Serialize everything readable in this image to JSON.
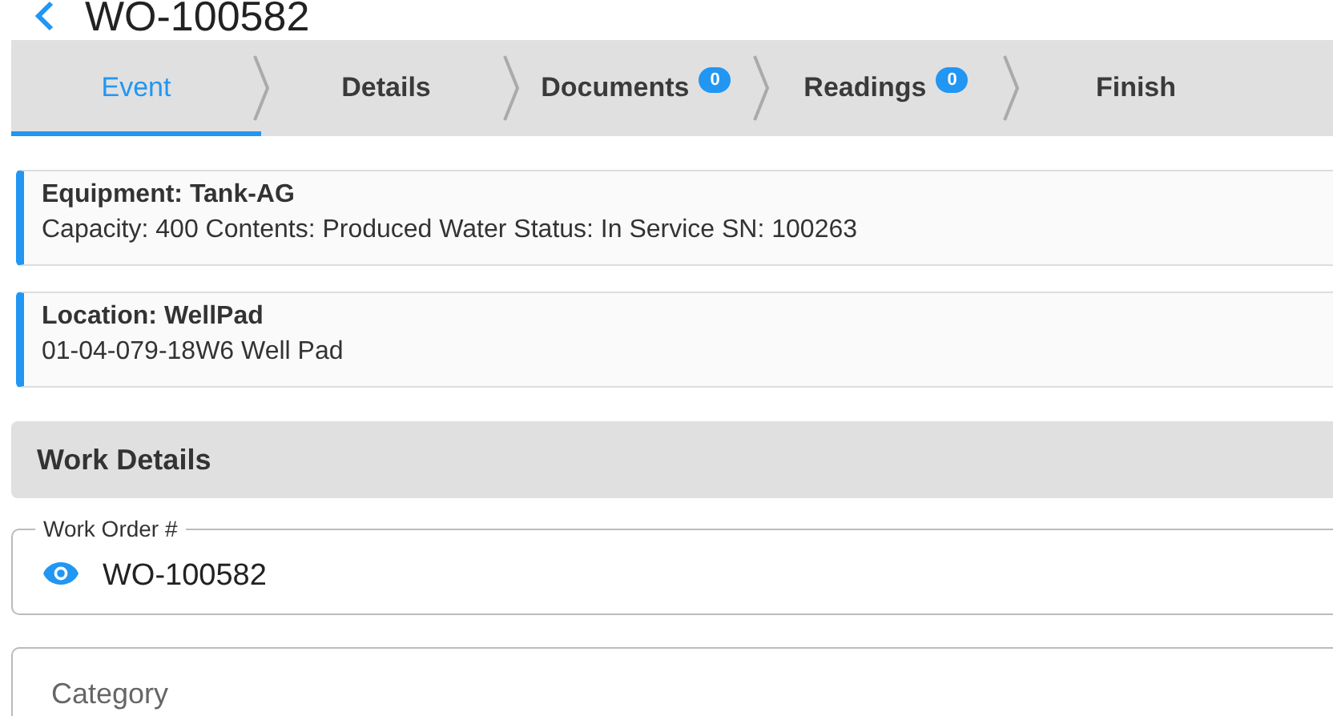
{
  "header": {
    "title": "WO-100582"
  },
  "steps": [
    {
      "label": "Event",
      "selected": true
    },
    {
      "label": "Details",
      "selected": false
    },
    {
      "label": "Documents",
      "badge": "0",
      "selected": false
    },
    {
      "label": "Readings",
      "badge": "0",
      "selected": false
    },
    {
      "label": "Finish",
      "selected": false
    }
  ],
  "info_cards": [
    {
      "title": "Equipment: Tank-AG",
      "detail": "Capacity: 400 Contents: Produced Water Status: In Service SN: 100263"
    },
    {
      "title": "Location: WellPad",
      "detail": "01-04-079-18W6 Well Pad"
    }
  ],
  "section": {
    "title": "Work Details"
  },
  "fields": [
    {
      "label": "Work Order #",
      "value": "WO-100582",
      "kind": "readonly"
    },
    {
      "placeholder": "Category",
      "kind": "select"
    }
  ]
}
